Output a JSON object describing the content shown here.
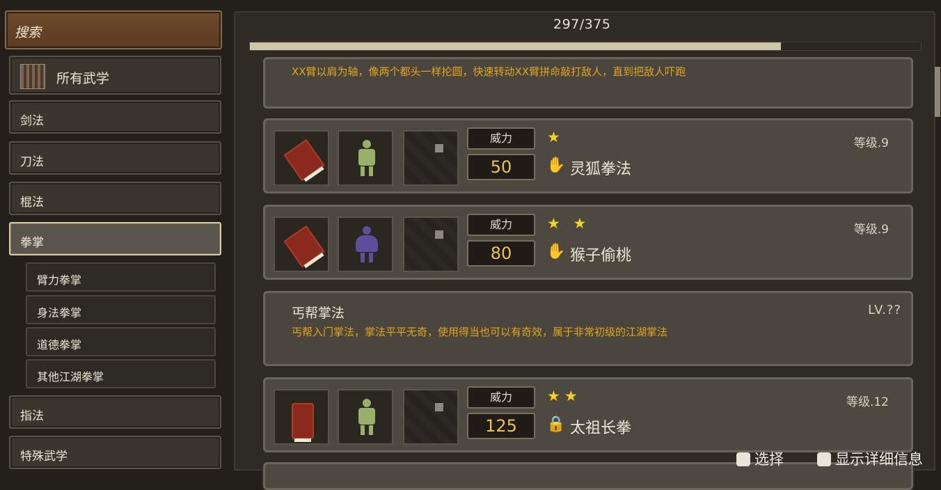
{
  "sidebar": {
    "search_label": "搜索",
    "all_label": "所有武学",
    "categories": [
      "剑法",
      "刀法",
      "棍法",
      "拳掌"
    ],
    "subcategories": [
      "臂力拳掌",
      "身法拳掌",
      "道德拳掌",
      "其他江湖拳掌"
    ],
    "more_categories": [
      "指法",
      "特殊武学"
    ],
    "active_category": "拳掌"
  },
  "progress": {
    "label": "297/375",
    "current": 297,
    "total": 375
  },
  "top_desc": {
    "text": "XX臂以肩为轴，像两个都头一样抡圆，快速转动XX臂拼命敲打敌人，直到把敌人吓跑"
  },
  "cards": [
    {
      "power_label": "威力",
      "power": "50",
      "stars": "★",
      "name": "灵狐拳法",
      "level": "等级.9",
      "hand_icon": "hand-icon",
      "figure": "green"
    },
    {
      "power_label": "威力",
      "power": "80",
      "stars": "★ ★",
      "name": "猴子偷桃",
      "level": "等级.9",
      "hand_icon": "hand-icon",
      "figure": "purple"
    },
    {
      "power_label": "威力",
      "power": "125",
      "stars": "★★",
      "name": "太祖长拳",
      "level": "等级.12",
      "hand_icon": "lock-icon",
      "figure": "green"
    }
  ],
  "detail": {
    "title": "丐帮掌法",
    "level": "LV.??",
    "text": "丐帮入门掌法，掌法平平无奇，使用得当也可以有奇效，属于非常初级的江湖掌法"
  },
  "footer": {
    "select_label": "选择",
    "detail_label": "显示详细信息"
  },
  "colors": {
    "accent_gold": "#f1c24a",
    "desc_orange": "#e3a51b",
    "search_brown": "#6e4a2c",
    "active_border": "#d9cc9c"
  }
}
